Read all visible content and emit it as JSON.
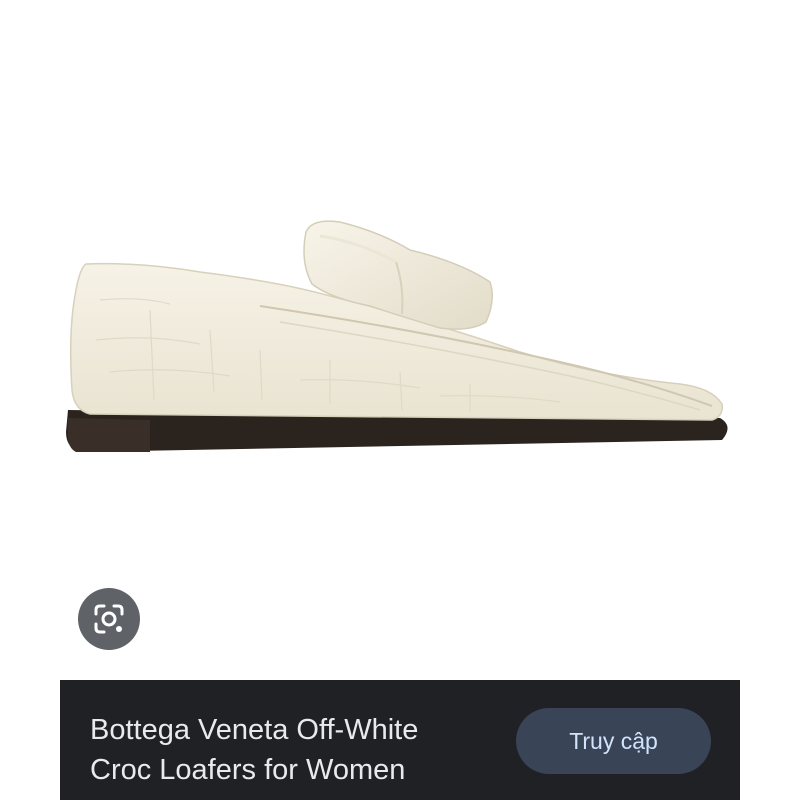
{
  "image": {
    "subject": "off-white croc-embossed leather loafer",
    "colors": {
      "leather": "#f1ecdc",
      "sole": "#2b231e",
      "background": "#ffffff"
    }
  },
  "lens": {
    "icon": "lens-search-icon",
    "color": "#5f6368"
  },
  "info_bar": {
    "title_line1": "Bottega Veneta Off-White",
    "title_line2": "Croc Loafers for Women",
    "visit_label": "Truy cập",
    "background": "#202124",
    "button_color": "#394457"
  }
}
